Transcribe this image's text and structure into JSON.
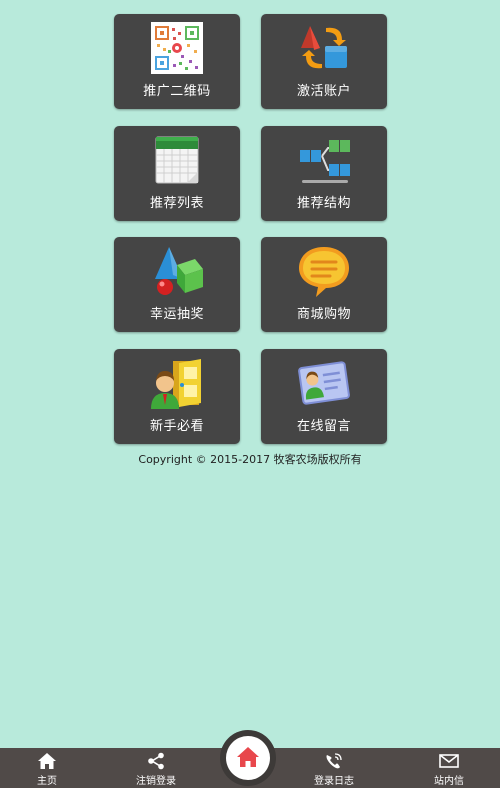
{
  "tiles": [
    {
      "label": "推广二维码",
      "icon": "qr-code-icon"
    },
    {
      "label": "激活账户",
      "icon": "activate-account-icon"
    },
    {
      "label": "推荐列表",
      "icon": "calendar-list-icon"
    },
    {
      "label": "推荐结构",
      "icon": "structure-tree-icon"
    },
    {
      "label": "幸运抽奖",
      "icon": "lottery-shapes-icon"
    },
    {
      "label": "商城购物",
      "icon": "chat-bubble-icon"
    },
    {
      "label": "新手必看",
      "icon": "newbie-door-icon"
    },
    {
      "label": "在线留言",
      "icon": "message-card-icon"
    }
  ],
  "footer": {
    "copyright": "Copyright © 2015-2017 牧客农场版权所有"
  },
  "nav": {
    "home": {
      "label": "主页",
      "icon": "home-icon"
    },
    "logout": {
      "label": "注销登录",
      "icon": "share-icon"
    },
    "center": {
      "icon": "home-icon",
      "color": "#e8474c"
    },
    "log": {
      "label": "登录日志",
      "icon": "phone-icon"
    },
    "mail": {
      "label": "站内信",
      "icon": "mail-icon"
    }
  },
  "colors": {
    "background": "#b8eadb",
    "tile": "#454545",
    "bar": "#504a48",
    "accent": "#e8474c"
  }
}
